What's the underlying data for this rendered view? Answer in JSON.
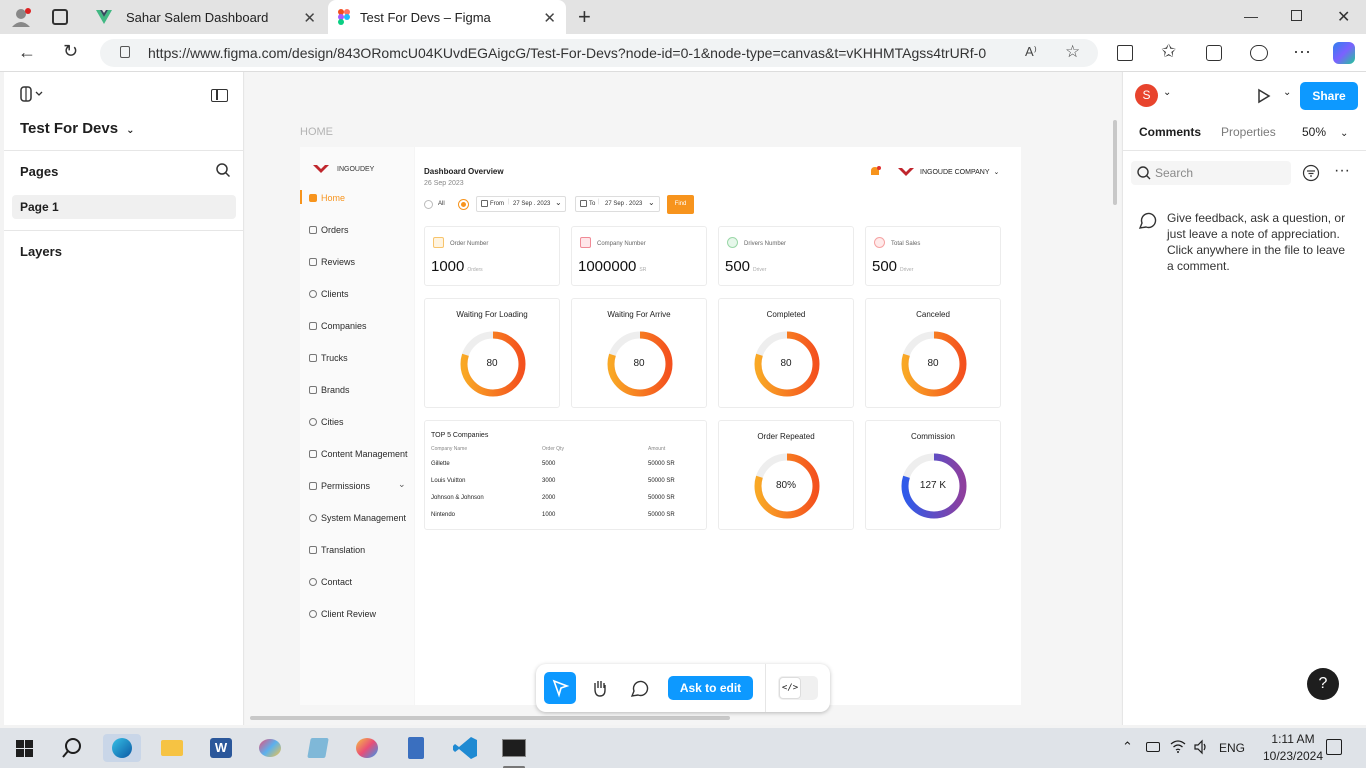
{
  "browser": {
    "tabs": [
      {
        "label": "Sahar Salem Dashboard"
      },
      {
        "label": "Test For Devs – Figma"
      }
    ],
    "url": "https://www.figma.com/design/843ORomcU04KUvdEGAigcG/Test-For-Devs?node-id=0-1&node-type=canvas&t=vKHHMTAgss4trURf-0"
  },
  "figma": {
    "file_name": "Test For Devs",
    "pages_label": "Pages",
    "page_item": "Page 1",
    "layers_label": "Layers",
    "avatar_letter": "S",
    "share_label": "Share",
    "tabs": {
      "comments": "Comments",
      "properties": "Properties"
    },
    "zoom": "50%",
    "search_placeholder": "Search",
    "comment_hint": "Give feedback, ask a question, or just leave a note of appreciation. Click anywhere in the file to leave a comment.",
    "ask_to_edit": "Ask to edit",
    "help": "?"
  },
  "design": {
    "canvas_label": "HOME",
    "brand": "INGOUDEY",
    "nav": [
      "Home",
      "Orders",
      "Reviews",
      "Clients",
      "Companies",
      "Trucks",
      "Brands",
      "Cities",
      "Content Management",
      "Permissions",
      "System Management",
      "Translation",
      "Contact",
      "Client Review"
    ],
    "title": "Dashboard Overview",
    "date": "26 Sep 2023",
    "company": "INGOUDE COMPANY",
    "filter": {
      "all": "All",
      "from_label": "From",
      "from_date": "27 Sep . 2023",
      "to_label": "To",
      "to_date": "27 Sep . 2023",
      "find": "Find"
    },
    "stats": [
      {
        "label": "Order Number",
        "value": "1000",
        "unit": "Orders"
      },
      {
        "label": "Company Number",
        "value": "1000000",
        "unit": "SR"
      },
      {
        "label": "Drivers Number",
        "value": "500",
        "unit": "Driver"
      },
      {
        "label": "Total Sales",
        "value": "500",
        "unit": "Driver"
      }
    ],
    "donuts": [
      {
        "title": "Waiting For Loading",
        "value": "80"
      },
      {
        "title": "Waiting For Arrive",
        "value": "80"
      },
      {
        "title": "Completed",
        "value": "80"
      },
      {
        "title": "Canceled",
        "value": "80"
      }
    ],
    "top_companies": {
      "title": "TOP 5 Companies",
      "headers": [
        "Company Name",
        "Order Qty",
        "Amount"
      ],
      "rows": [
        [
          "Gillette",
          "5000",
          "50000 SR"
        ],
        [
          "Louis Vuitton",
          "3000",
          "50000 SR"
        ],
        [
          "Johnson & Johnson",
          "2000",
          "50000 SR"
        ],
        [
          "Nintendo",
          "1000",
          "50000 SR"
        ]
      ]
    },
    "order_repeated": {
      "title": "Order Repeated",
      "value": "80%"
    },
    "commission": {
      "title": "Commission",
      "value": "127 K"
    }
  },
  "taskbar": {
    "lang": "ENG",
    "time": "1:11 AM",
    "date": "10/23/2024"
  },
  "colors": {
    "accent_orange": "#f7941d",
    "figma_blue": "#0d99ff",
    "commission_blue": "#3b5bdb",
    "commission_purple": "#7b3f9e"
  }
}
